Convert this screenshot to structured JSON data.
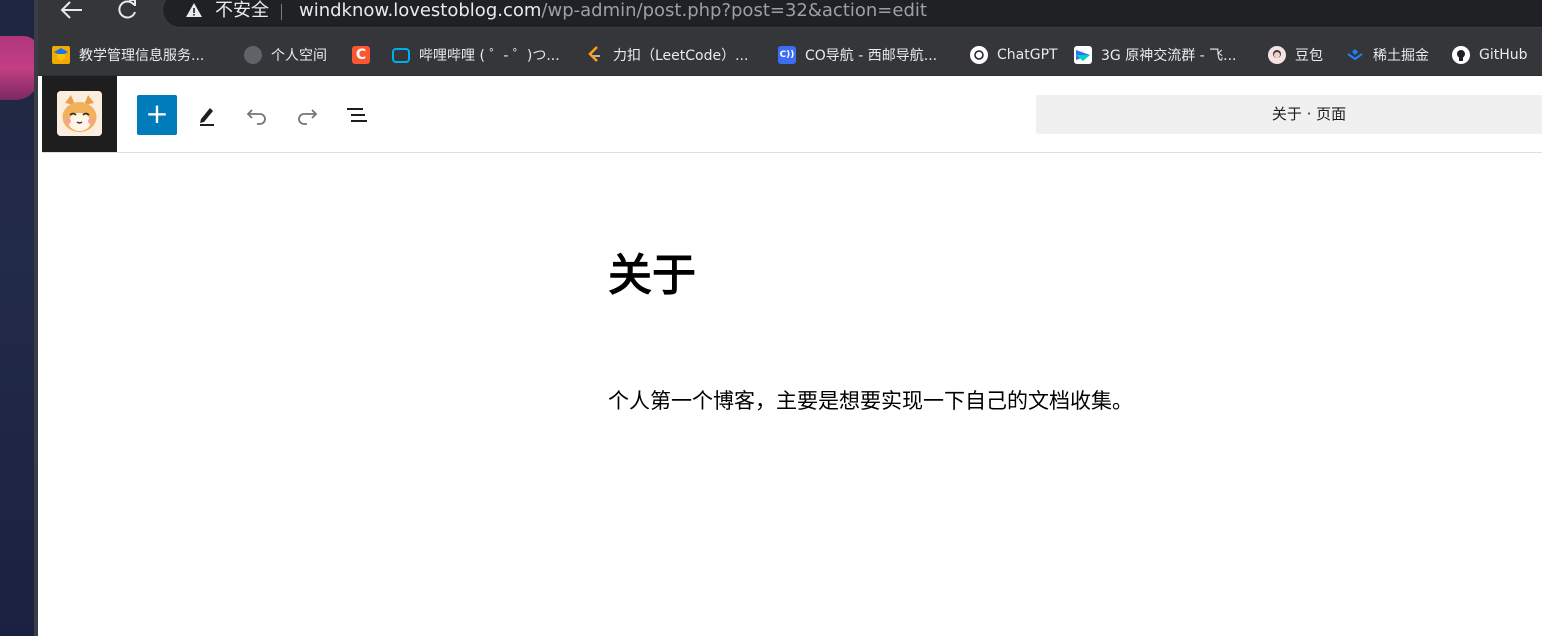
{
  "browser": {
    "address_bar": {
      "security_label": "不安全",
      "url_host": "windknow.lovestoblog.com",
      "url_path": "/wp-admin/post.php?post=32&action=edit"
    },
    "bookmarks": [
      {
        "label": "教学管理信息服务...",
        "icon": "academic-icon",
        "color": "#f2a900"
      },
      {
        "label": "个人空间",
        "icon": "globe-icon",
        "color": "#5f6368"
      },
      {
        "label": "",
        "icon": "csdn-icon",
        "color": "#fc5531"
      },
      {
        "label": "哔哩哔哩 ( ゜- ゜)つ...",
        "icon": "bilibili-icon",
        "color": "#00aeec"
      },
      {
        "label": "力扣（LeetCode）...",
        "icon": "leetcode-icon",
        "color": "#ffa116"
      },
      {
        "label": "CO导航 - 西邮导航...",
        "icon": "co-nav-icon",
        "color": "#3b6ef5"
      },
      {
        "label": "ChatGPT",
        "icon": "chatgpt-icon",
        "color": "#ffffff"
      },
      {
        "label": "3G 原神交流群 - 飞...",
        "icon": "feishu-icon",
        "color": "#3370ff"
      },
      {
        "label": "豆包",
        "icon": "doubao-icon",
        "color": "#f4c6c6"
      },
      {
        "label": "稀土掘金",
        "icon": "juejin-icon",
        "color": "#1e80ff"
      },
      {
        "label": "GitHub",
        "icon": "github-icon",
        "color": "#ffffff"
      }
    ]
  },
  "wp_editor": {
    "header": {
      "add_block_label": "+",
      "document_title": "关于 · 页面"
    },
    "post": {
      "title": "关于",
      "paragraph": "个人第一个博客，主要是想要实现一下自己的文档收集。"
    }
  },
  "colors": {
    "wp_accent": "#007cba",
    "chrome_toolbar": "#35363a",
    "omnibox_bg": "#202124"
  }
}
